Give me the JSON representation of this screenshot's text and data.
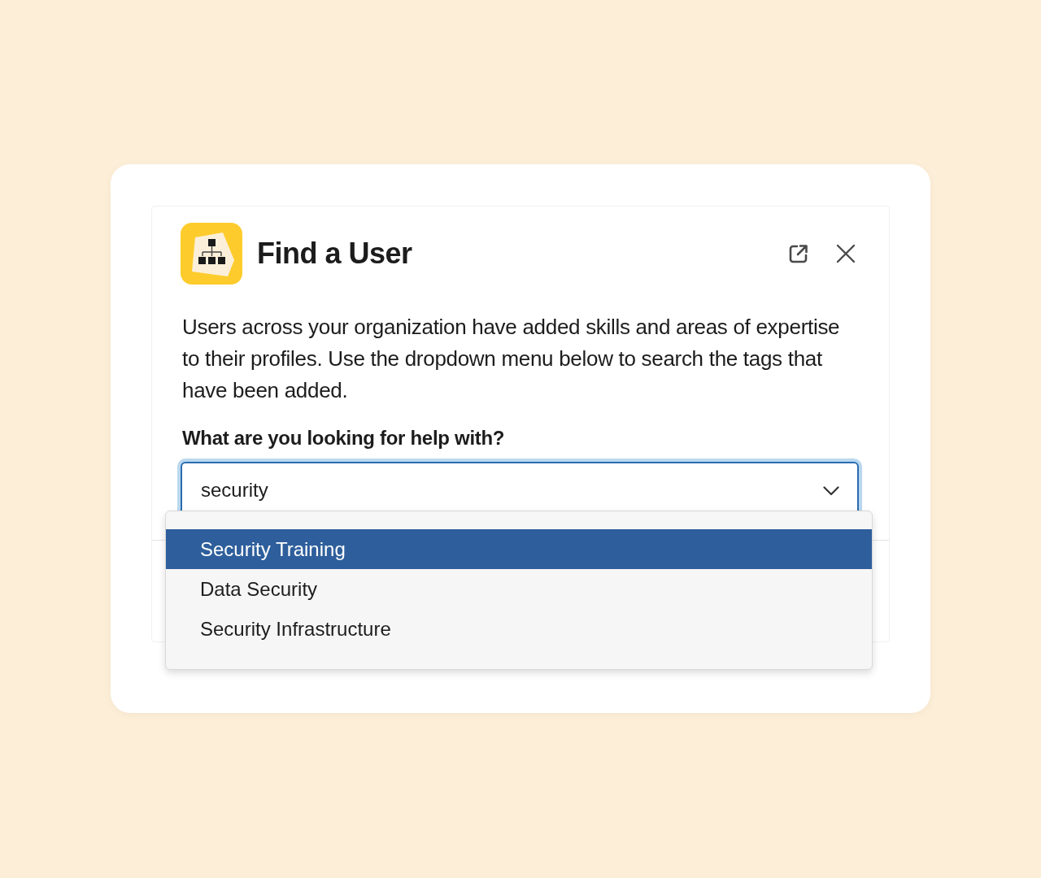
{
  "dialog": {
    "title": "Find a User",
    "description": "Users across your organization have added skills and areas of expertise to their profiles. Use the dropdown menu below to search the tags that have been added.",
    "field_label": "What are you looking for help with?",
    "select": {
      "value": "security",
      "expanded": true
    },
    "options": [
      {
        "label": "Security Training",
        "selected": true
      },
      {
        "label": "Data Security",
        "selected": false
      },
      {
        "label": "Security Infrastructure",
        "selected": false
      }
    ]
  }
}
